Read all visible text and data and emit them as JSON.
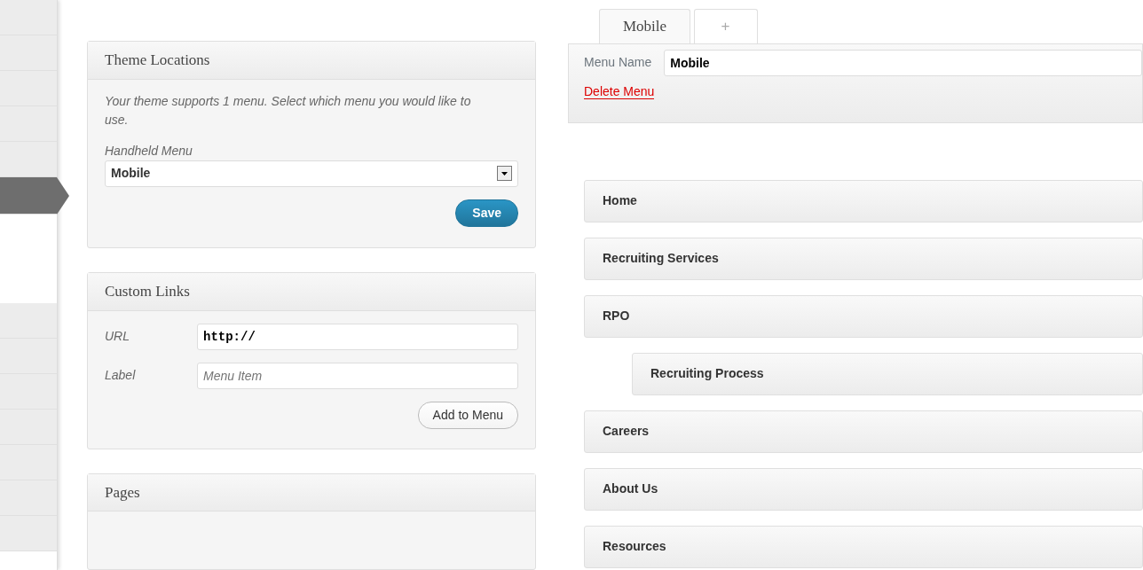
{
  "sidebar": {
    "items": [
      {
        "selected": false
      },
      {
        "selected": false
      },
      {
        "selected": false
      },
      {
        "selected": false
      },
      {
        "selected": false
      },
      {
        "selected": true
      }
    ],
    "lower_items": [
      {
        "selected": false
      },
      {
        "selected": false
      },
      {
        "selected": false
      },
      {
        "selected": false
      },
      {
        "selected": false
      },
      {
        "selected": false
      },
      {
        "selected": false
      }
    ]
  },
  "theme_locations": {
    "title": "Theme Locations",
    "description": "Your theme supports 1 menu. Select which menu you would like to use.",
    "field_label": "Handheld Menu",
    "selected_menu": "Mobile",
    "save_button": "Save"
  },
  "custom_links": {
    "title": "Custom Links",
    "url_label": "URL",
    "url_value": "http://",
    "label_label": "Label",
    "label_placeholder": "Menu Item",
    "add_button": "Add to Menu"
  },
  "pages": {
    "title": "Pages"
  },
  "menu_tabs": [
    {
      "label": "Mobile",
      "selected": true
    },
    {
      "label": "+",
      "selected": false
    }
  ],
  "menu_name_label": "Menu Name",
  "menu_name_value": "Mobile",
  "delete_link": "Delete Menu",
  "menu_items": [
    {
      "label": "Home"
    },
    {
      "label": "Recruiting Services"
    },
    {
      "label": "RPO",
      "children": [
        {
          "label": "Recruiting Process"
        }
      ]
    },
    {
      "label": "Careers"
    },
    {
      "label": "About Us"
    },
    {
      "label": "Resources"
    }
  ]
}
